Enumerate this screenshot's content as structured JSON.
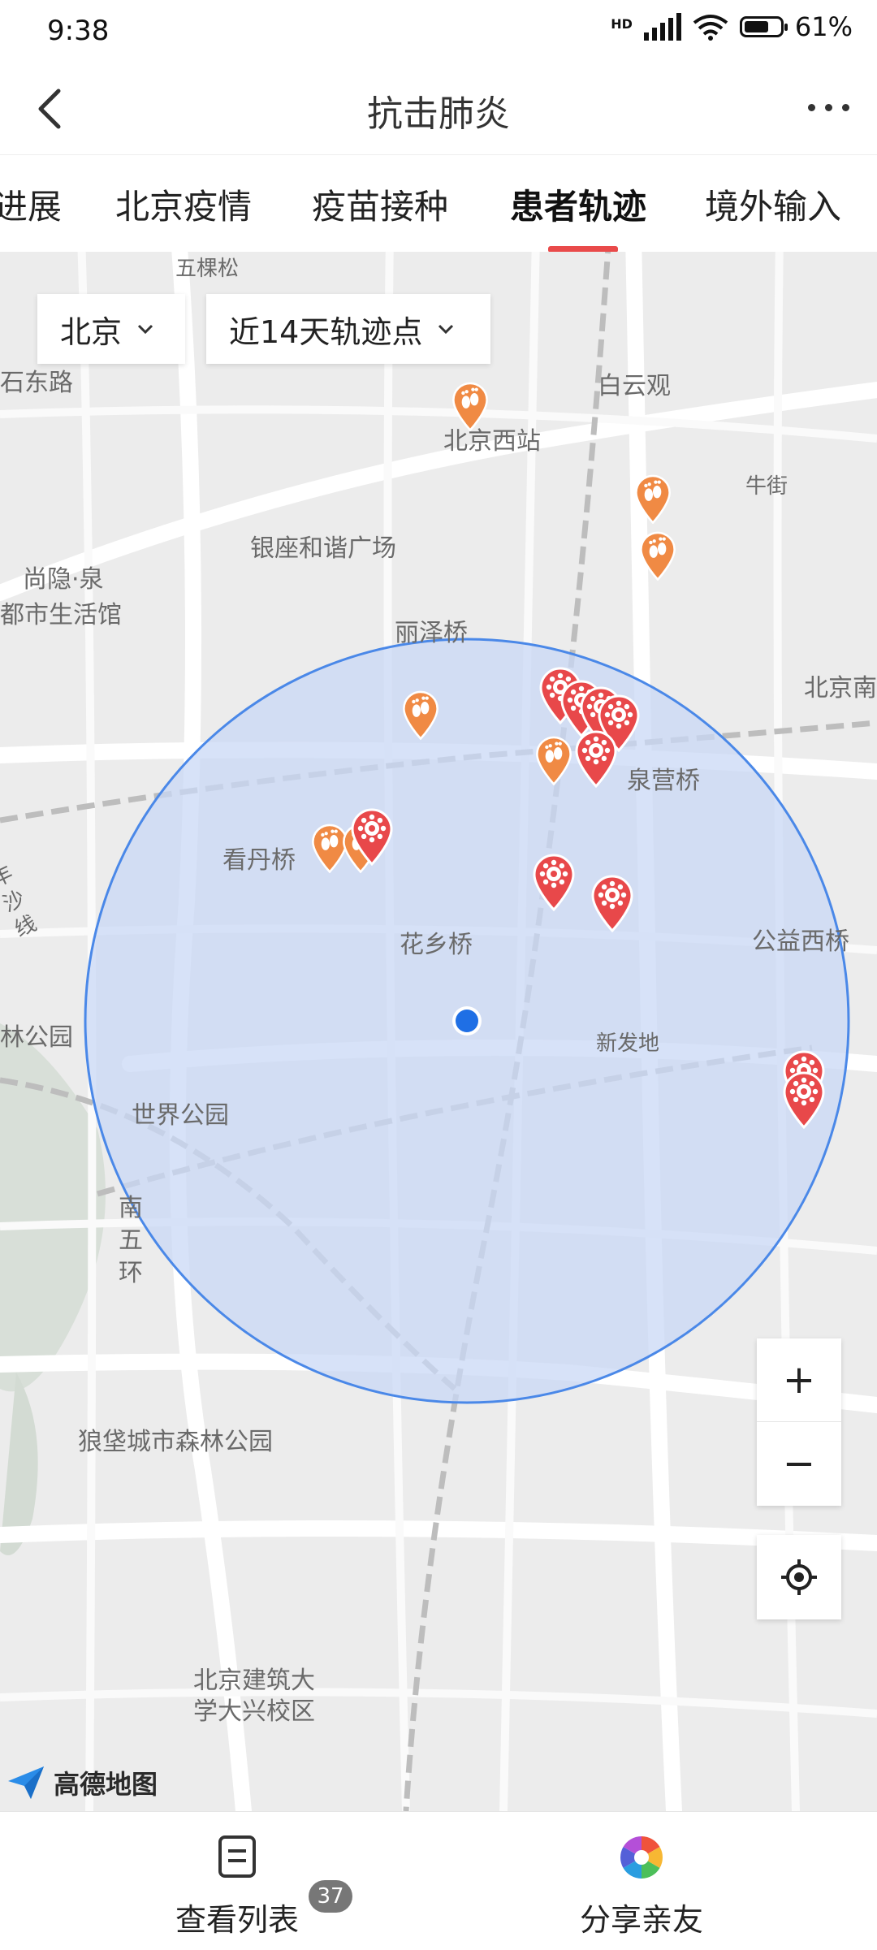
{
  "status": {
    "time": "9:38",
    "network": "HD",
    "battery": "61%"
  },
  "header": {
    "title": "抗击肺炎"
  },
  "tabs": [
    "进展",
    "北京疫情",
    "疫苗接种",
    "患者轨迹",
    "境外输入"
  ],
  "active_tab": "患者轨迹",
  "filters": {
    "city": "北京",
    "range": "近14天轨迹点"
  },
  "map_labels": {
    "wukesong": "五棵松",
    "shidonglu": "石东路",
    "baiyunguan": "白云观",
    "beijingxizhan": "北京西站",
    "niujie": "牛街",
    "yinzuo": "银座和谐广场",
    "shangyinquan": "尚隐·泉",
    "dushi": "都市生活馆",
    "lizeqiao": "丽泽桥",
    "beijingnan": "北京南",
    "quanying": "泉营桥",
    "kandanqiao": "看丹桥",
    "huaxiangqiao": "花乡桥",
    "gongyixi": "公益西桥",
    "xinfadi": "新发地",
    "shijiegongyuan": "世界公园",
    "linpark": "林公园",
    "nanwuhuan": "南五环",
    "shasha": "丰沙线",
    "langbao": "狼垡城市森林公园",
    "jianzhu1": "北京建筑大",
    "jianzhu2": "学大兴校区"
  },
  "map_logo": "高德地图",
  "zoom": {
    "plus": "+",
    "minus": "−"
  },
  "markers": {
    "trajectory_icon": "footprint-icon",
    "case_icon": "virus-icon",
    "trajectory_color": "#f08a44",
    "case_color": "#e8484a",
    "location_color": "#1f6fe5",
    "radius_fill": "#c9d8f5"
  },
  "bottom": {
    "list_label": "查看列表",
    "list_count": "37",
    "share_label": "分享亲友"
  }
}
